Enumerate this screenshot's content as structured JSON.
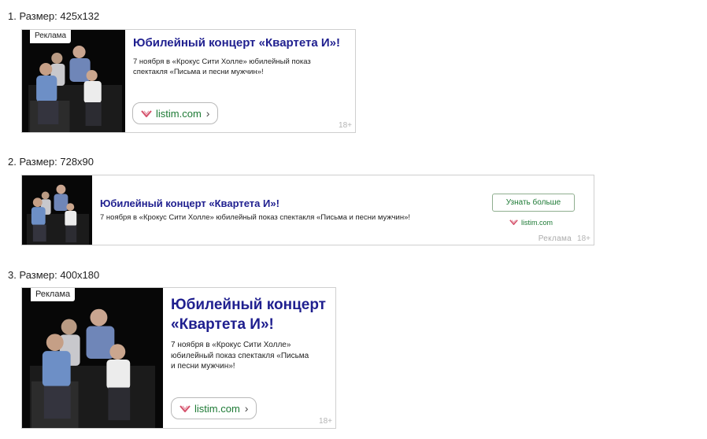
{
  "sections": [
    {
      "label": "1. Размер: 425x132"
    },
    {
      "label": "2. Размер: 728x90"
    },
    {
      "label": "3. Размер: 400x180"
    }
  ],
  "ad": {
    "badge": "Реклама",
    "title": "Юбилейный концерт «Квартета И»!",
    "title_line1": "Юбилейный концерт",
    "title_line2": "«Квартета И»!",
    "description": "7 ноября в «Крокус Сити Холле» юбилейный показ спектакля «Письма и песни мужчин»!",
    "desc_lines_a": [
      "7 ноября в «Крокус Сити Холле» юбилейный показ",
      "спектакля «Письма и песни мужчин»!"
    ],
    "desc_lines_c": [
      "7 ноября в «Крокус Сити Холле»",
      "юбилейный показ спектакля «Письма",
      "и песни мужчин»!"
    ],
    "domain": "listim.com",
    "chevron": "›",
    "age": "18+",
    "more_button": "Узнать больше",
    "footer_label": "Реклама"
  },
  "colors": {
    "title": "#1f1f8f",
    "domain": "#1d7a35",
    "logo": "#d4506a"
  },
  "icons": [
    "listim-logo-icon",
    "chevron-right-icon"
  ]
}
